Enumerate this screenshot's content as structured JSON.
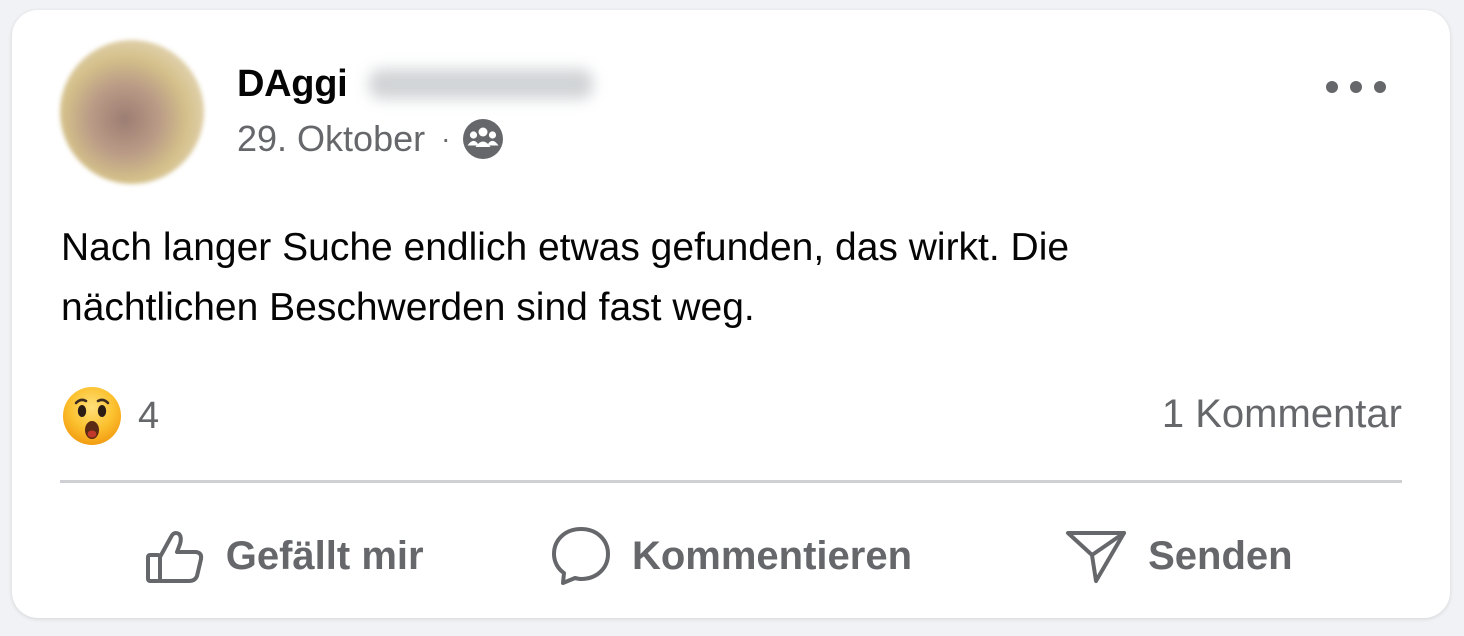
{
  "post": {
    "author": {
      "name": "DAggi",
      "surname_hidden": "(blurred)"
    },
    "date": "29. Oktober",
    "separator": "·",
    "audience_icon": "group-icon",
    "text": "Nach langer Suche endlich etwas gefunden, das wirkt. Die\nnächtlichen Beschwerden sind fast weg.",
    "reaction": {
      "icon": "wow-reaction-icon",
      "count": "4"
    },
    "comments_label": "1 Kommentar"
  },
  "actions": {
    "like": "Gefällt mir",
    "comment": "Kommentieren",
    "send": "Senden"
  },
  "colors": {
    "text_primary": "#050505",
    "text_secondary": "#65676b",
    "divider": "#ced0d4",
    "card_bg": "#ffffff"
  }
}
